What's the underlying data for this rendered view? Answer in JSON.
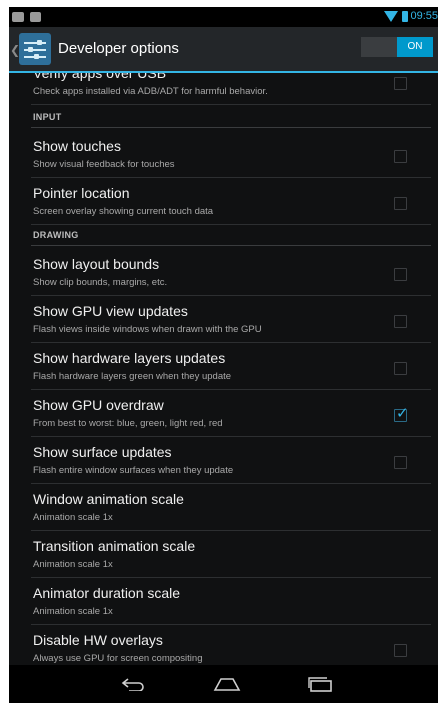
{
  "status_bar": {
    "time": "09:55"
  },
  "action_bar": {
    "title": "Developer options",
    "toggle_label": "ON"
  },
  "items": [
    {
      "title": "Verify apps over USB",
      "summary": "Check apps installed via ADB/ADT for harmful behavior.",
      "checkbox": true,
      "checked": false
    },
    {
      "header": "INPUT"
    },
    {
      "title": "Show touches",
      "summary": "Show visual feedback for touches",
      "checkbox": true,
      "checked": false
    },
    {
      "title": "Pointer location",
      "summary": "Screen overlay showing current touch data",
      "checkbox": true,
      "checked": false
    },
    {
      "header": "DRAWING"
    },
    {
      "title": "Show layout bounds",
      "summary": "Show clip bounds, margins, etc.",
      "checkbox": true,
      "checked": false
    },
    {
      "title": "Show GPU view updates",
      "summary": "Flash views inside windows when drawn with the GPU",
      "checkbox": true,
      "checked": false
    },
    {
      "title": "Show hardware layers updates",
      "summary": "Flash hardware layers green when they update",
      "checkbox": true,
      "checked": false
    },
    {
      "title": "Show GPU overdraw",
      "summary": "From best to worst: blue, green, light red, red",
      "checkbox": true,
      "checked": true
    },
    {
      "title": "Show surface updates",
      "summary": "Flash entire window surfaces when they update",
      "checkbox": true,
      "checked": false
    },
    {
      "title": "Window animation scale",
      "summary": "Animation scale 1x",
      "checkbox": false
    },
    {
      "title": "Transition animation scale",
      "summary": "Animation scale 1x",
      "checkbox": false
    },
    {
      "title": "Animator duration scale",
      "summary": "Animation scale 1x",
      "checkbox": false
    },
    {
      "title": "Disable HW overlays",
      "summary": "Always use GPU for screen compositing",
      "checkbox": true,
      "checked": false
    }
  ],
  "nav_bar": {
    "icons": [
      "back-icon",
      "home-icon",
      "recent-apps-icon"
    ]
  },
  "colors": {
    "accent": "#33b5e5",
    "background": "#101112",
    "action_bar": "#232629"
  }
}
